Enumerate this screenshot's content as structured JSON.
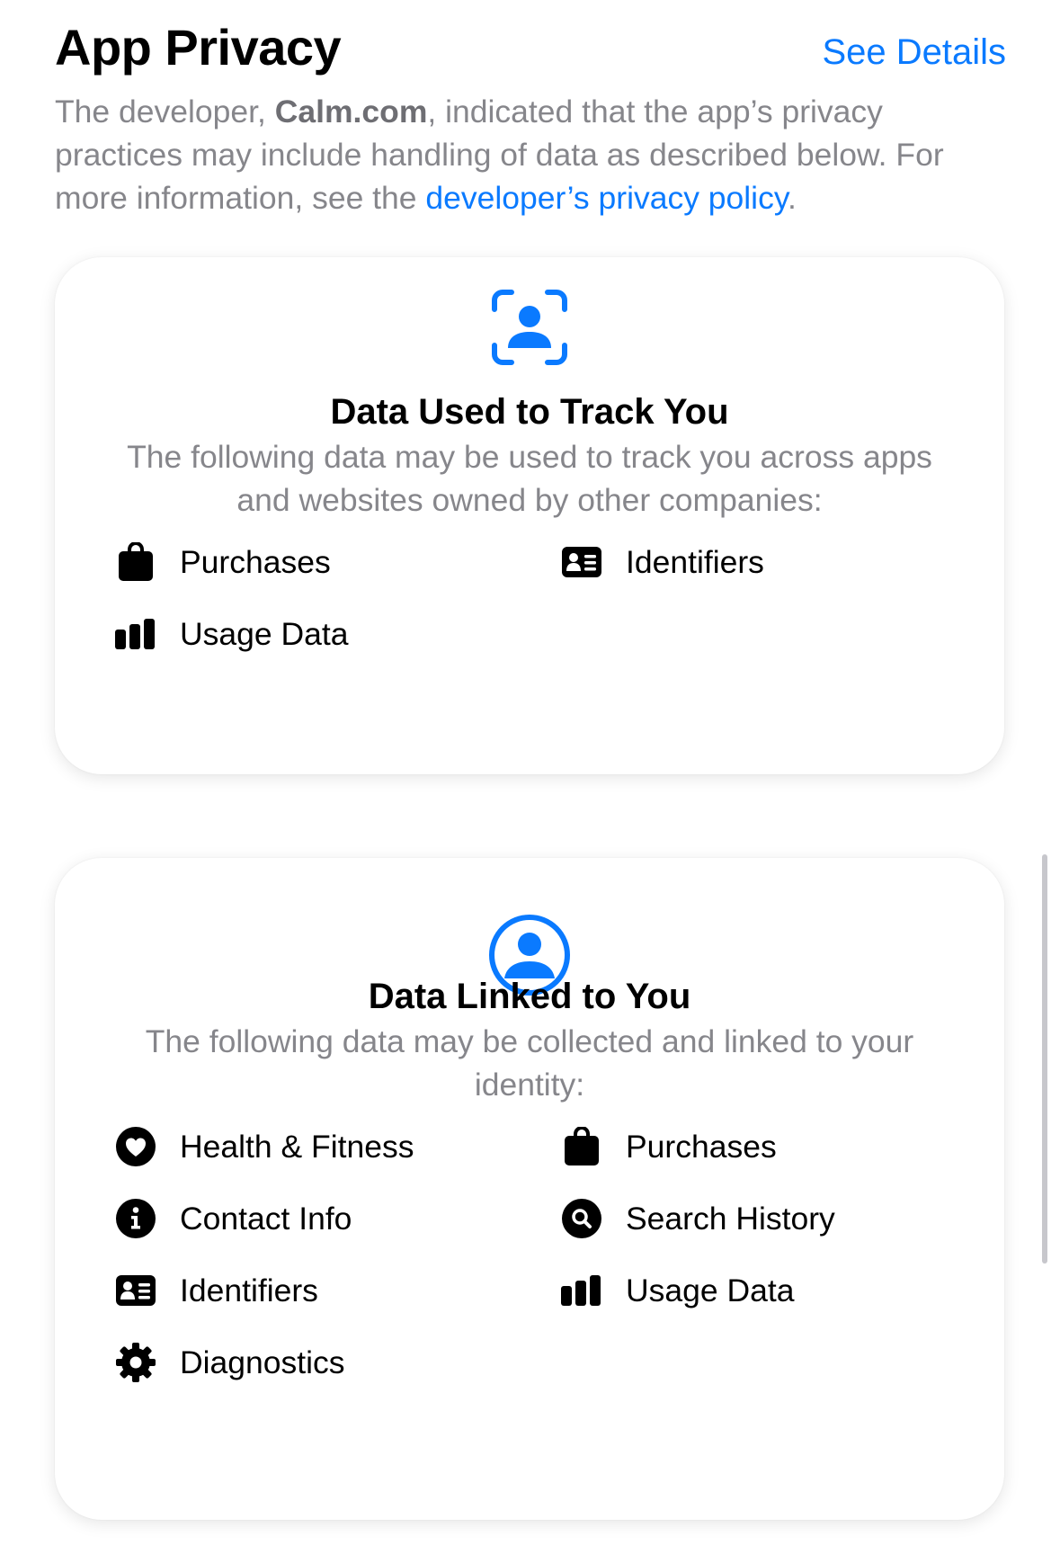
{
  "header": {
    "title": "App Privacy",
    "see_details": "See Details"
  },
  "intro": {
    "text_1": "The developer, ",
    "developer": "Calm.com",
    "text_2": ", indicated that the app’s privacy practices may include handling of data as described below. For more information, see the ",
    "policy_link": "developer’s privacy policy",
    "text_3": "."
  },
  "tracking": {
    "icon": "person-viewfinder-icon",
    "title": "Data Used to Track You",
    "description": "The following data may be used to track you across apps and websites owned by other companies:",
    "items": [
      {
        "label": "Purchases",
        "icon": "shopping-bag-icon"
      },
      {
        "label": "Identifiers",
        "icon": "id-card-icon"
      },
      {
        "label": "Usage Data",
        "icon": "bar-chart-icon"
      }
    ]
  },
  "linked": {
    "icon": "person-circle-icon",
    "title": "Data Linked to You",
    "description": "The following data may be collected and linked to your identity:",
    "items": [
      {
        "label": "Health & Fitness",
        "icon": "heart-circle-icon"
      },
      {
        "label": "Purchases",
        "icon": "shopping-bag-icon"
      },
      {
        "label": "Contact Info",
        "icon": "info-circle-icon"
      },
      {
        "label": "Search History",
        "icon": "search-circle-icon"
      },
      {
        "label": "Identifiers",
        "icon": "id-card-icon"
      },
      {
        "label": "Usage Data",
        "icon": "bar-chart-icon"
      },
      {
        "label": "Diagnostics",
        "icon": "gear-icon"
      }
    ]
  },
  "colors": {
    "accent": "#0a7aff",
    "secondary_text": "#86868b"
  }
}
